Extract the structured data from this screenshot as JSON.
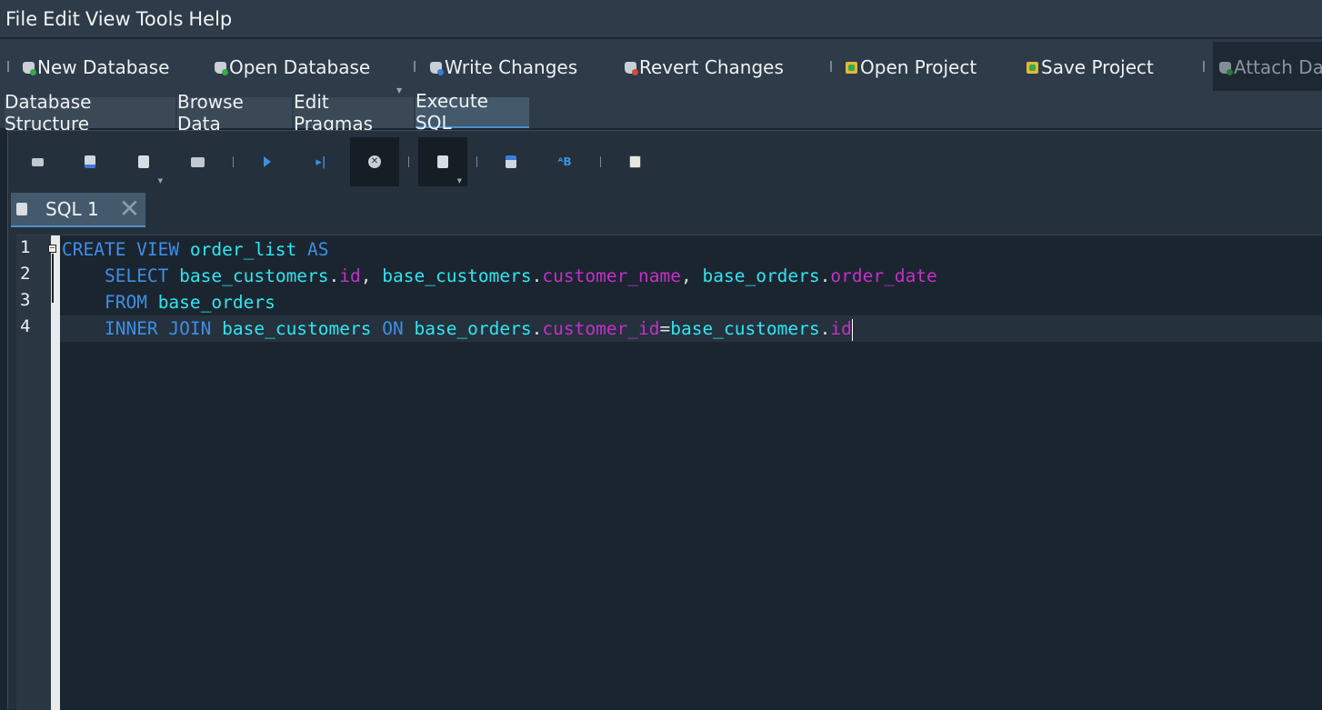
{
  "menu": [
    "File",
    "Edit",
    "View",
    "Tools",
    "Help"
  ],
  "toolbar": {
    "new_database": "New Database",
    "open_database": "Open Database",
    "write_changes": "Write Changes",
    "revert_changes": "Revert Changes",
    "open_project": "Open Project",
    "save_project": "Save Project",
    "attach_database": "Attach Dat"
  },
  "tabs": [
    "Database Structure",
    "Browse Data",
    "Edit Pragmas",
    "Execute SQL"
  ],
  "active_tab": "Execute SQL",
  "sql_toolbar_icons": [
    "open-tab-icon",
    "open-sql-file-icon",
    "save-sql-file-icon",
    "print-icon",
    "execute-all-icon",
    "execute-current-line-icon",
    "stop-execution-icon",
    "save-results-icon",
    "find-icon",
    "find-replace-icon",
    "comment-icon"
  ],
  "editor_tab": {
    "label": "SQL 1",
    "close": "✕"
  },
  "line_numbers": [
    "1",
    "2",
    "3",
    "4"
  ],
  "code": {
    "l1": {
      "kw1": "CREATE VIEW",
      "id1": "order_list",
      "kw2": "AS"
    },
    "l2": {
      "kw1": "SELECT",
      "t1": "base_customers",
      "c1": "id",
      "t2": "base_customers",
      "c2": "customer_name",
      "t3": "base_orders",
      "c3": "order_date"
    },
    "l3": {
      "kw1": "FROM",
      "t1": "base_orders"
    },
    "l4": {
      "kw1": "INNER JOIN",
      "t1": "base_customers",
      "kw2": "ON",
      "t2": "base_orders",
      "c1": "customer_id",
      "op": "=",
      "t3": "base_customers",
      "c2": "id"
    }
  },
  "colors": {
    "keyword": "#3f8ee6",
    "identifier": "#2de6f0",
    "column": "#c52fc9",
    "background": "#1b2530"
  }
}
